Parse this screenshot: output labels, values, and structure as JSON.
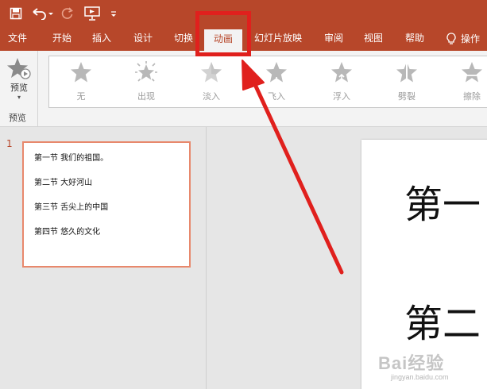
{
  "quick_access": {
    "icons": [
      "save-icon",
      "undo-icon",
      "redo-icon",
      "present-from-start-icon",
      "customize-qat-icon"
    ],
    "accent_color": "#b7472a"
  },
  "tabs": {
    "file": "文件",
    "home": "开始",
    "insert": "插入",
    "design": "设计",
    "transitions": "切换",
    "animations": "动画",
    "slideshow": "幻灯片放映",
    "review": "审阅",
    "view": "视图",
    "help": "帮助",
    "tell_me": "操作",
    "active": "动画",
    "highlight_color": "#e0201d"
  },
  "ribbon": {
    "preview_button": "预览",
    "preview_group": "预览",
    "animations": [
      {
        "label": "无",
        "icon": "star-none-icon"
      },
      {
        "label": "出现",
        "icon": "star-appear-icon"
      },
      {
        "label": "淡入",
        "icon": "star-fade-icon"
      },
      {
        "label": "飞入",
        "icon": "star-fly-in-icon"
      },
      {
        "label": "浮入",
        "icon": "star-float-in-icon"
      },
      {
        "label": "劈裂",
        "icon": "star-split-icon"
      },
      {
        "label": "擦除",
        "icon": "star-wipe-icon"
      }
    ]
  },
  "thumbnails": [
    {
      "number": "1",
      "lines": [
        "第一节  我们的祖国。",
        "第二节  大好河山",
        "第三节  舌尖上的中国",
        "第四节   悠久的文化"
      ]
    }
  ],
  "slide": {
    "line1": "第一",
    "line2": "第二"
  },
  "watermark": {
    "brand": "Bai经验",
    "url": "jingyan.baidu.com"
  }
}
